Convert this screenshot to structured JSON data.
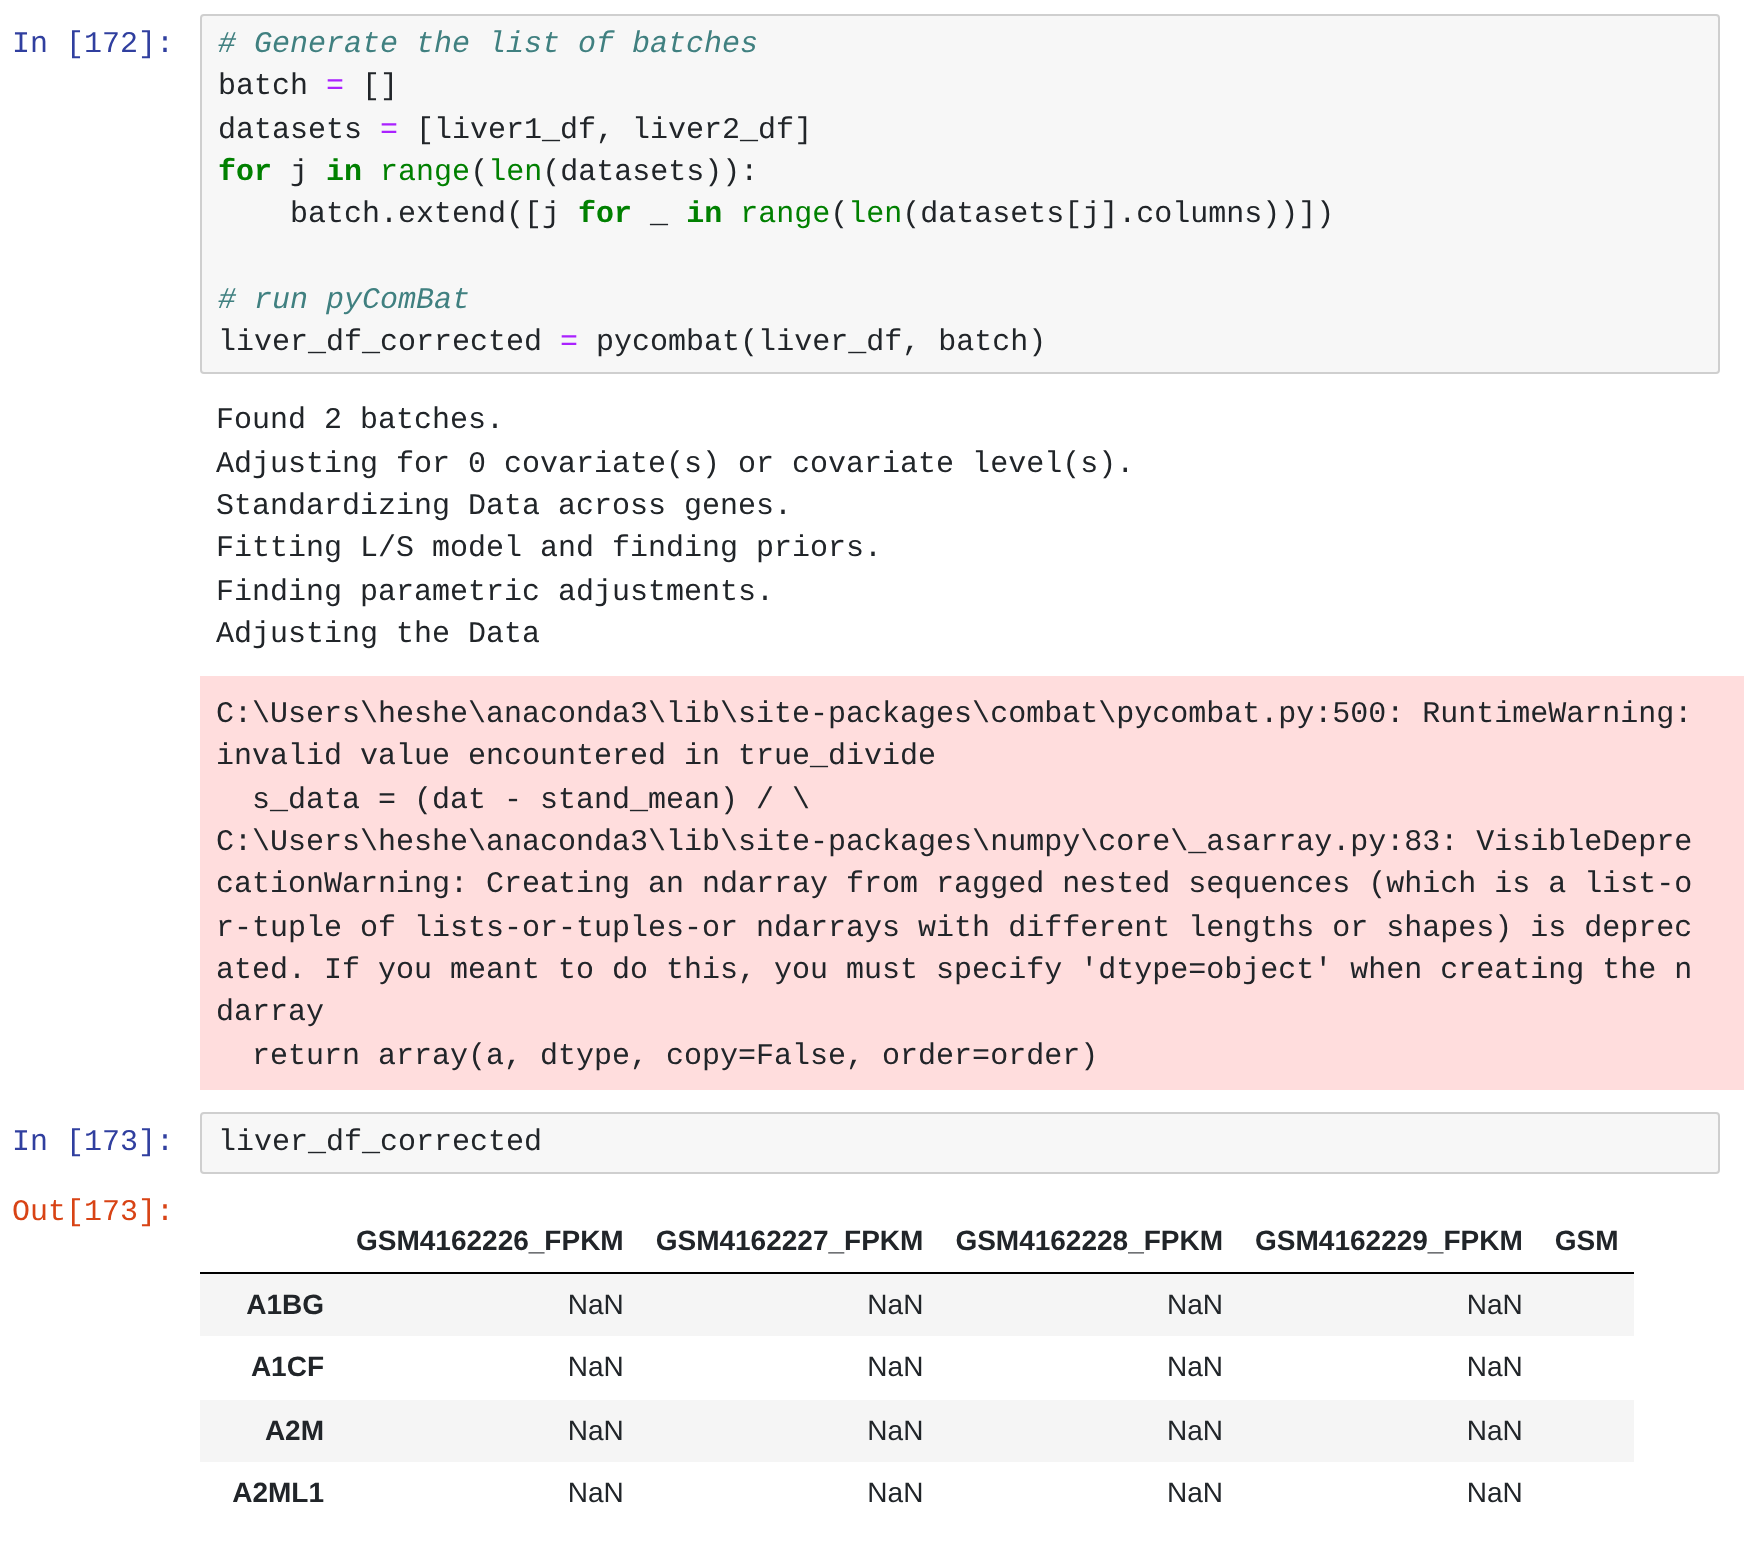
{
  "cells": [
    {
      "prompt": "In [172]:",
      "code": [
        [
          {
            "kind": "comment",
            "text": "# Generate the list of batches"
          }
        ],
        [
          {
            "kind": "plain",
            "text": "batch "
          },
          {
            "kind": "op",
            "text": "="
          },
          {
            "kind": "plain",
            "text": " []"
          }
        ],
        [
          {
            "kind": "plain",
            "text": "datasets "
          },
          {
            "kind": "op",
            "text": "="
          },
          {
            "kind": "plain",
            "text": " [liver1_df, liver2_df]"
          }
        ],
        [
          {
            "kind": "keyword",
            "text": "for"
          },
          {
            "kind": "plain",
            "text": " j "
          },
          {
            "kind": "keyword",
            "text": "in "
          },
          {
            "kind": "builtin",
            "text": "range"
          },
          {
            "kind": "plain",
            "text": "("
          },
          {
            "kind": "builtin",
            "text": "len"
          },
          {
            "kind": "plain",
            "text": "(datasets)):"
          }
        ],
        [
          {
            "kind": "plain",
            "text": "    batch.extend([j "
          },
          {
            "kind": "keyword",
            "text": "for"
          },
          {
            "kind": "plain",
            "text": " _ "
          },
          {
            "kind": "keyword",
            "text": "in "
          },
          {
            "kind": "builtin",
            "text": "range"
          },
          {
            "kind": "plain",
            "text": "("
          },
          {
            "kind": "builtin",
            "text": "len"
          },
          {
            "kind": "plain",
            "text": "(datasets[j].columns))])"
          }
        ],
        [
          {
            "kind": "blank"
          }
        ],
        [
          {
            "kind": "comment",
            "text": "# run pyComBat"
          }
        ],
        [
          {
            "kind": "plain",
            "text": "liver_df_corrected "
          },
          {
            "kind": "op",
            "text": "="
          },
          {
            "kind": "plain",
            "text": " pycombat(liver_df, batch)"
          }
        ]
      ],
      "outputs": [
        {
          "kind": "stream",
          "lines": [
            "Found 2 batches.",
            "Adjusting for 0 covariate(s) or covariate level(s).",
            "Standardizing Data across genes.",
            "Fitting L/S model and finding priors.",
            "Finding parametric adjustments.",
            "Adjusting the Data"
          ]
        },
        {
          "kind": "stderr",
          "lines": [
            "C:\\Users\\heshe\\anaconda3\\lib\\site-packages\\combat\\pycombat.py:500: RuntimeWarning:",
            "invalid value encountered in true_divide",
            "  s_data = (dat - stand_mean) / \\",
            "C:\\Users\\heshe\\anaconda3\\lib\\site-packages\\numpy\\core\\_asarray.py:83: VisibleDepre",
            "cationWarning: Creating an ndarray from ragged nested sequences (which is a list-o",
            "r-tuple of lists-or-tuples-or ndarrays with different lengths or shapes) is deprec",
            "ated. If you meant to do this, you must specify 'dtype=object' when creating the n",
            "darray",
            "  return array(a, dtype, copy=False, order=order)"
          ]
        }
      ]
    },
    {
      "prompt": "In [173]:",
      "code": [
        [
          {
            "kind": "plain",
            "text": "liver_df_corrected"
          }
        ]
      ],
      "out_prompt": "Out[173]:",
      "outputs": [
        {
          "kind": "table",
          "columns": [
            "GSM4162226_FPKM",
            "GSM4162227_FPKM",
            "GSM4162228_FPKM",
            "GSM4162229_FPKM",
            "GSM"
          ],
          "rows": [
            {
              "index": "A1BG",
              "values": [
                "NaN",
                "NaN",
                "NaN",
                "NaN"
              ]
            },
            {
              "index": "A1CF",
              "values": [
                "NaN",
                "NaN",
                "NaN",
                "NaN"
              ]
            },
            {
              "index": "A2M",
              "values": [
                "NaN",
                "NaN",
                "NaN",
                "NaN"
              ]
            },
            {
              "index": "A2ML1",
              "values": [
                "NaN",
                "NaN",
                "NaN",
                "NaN"
              ]
            }
          ]
        }
      ]
    }
  ]
}
